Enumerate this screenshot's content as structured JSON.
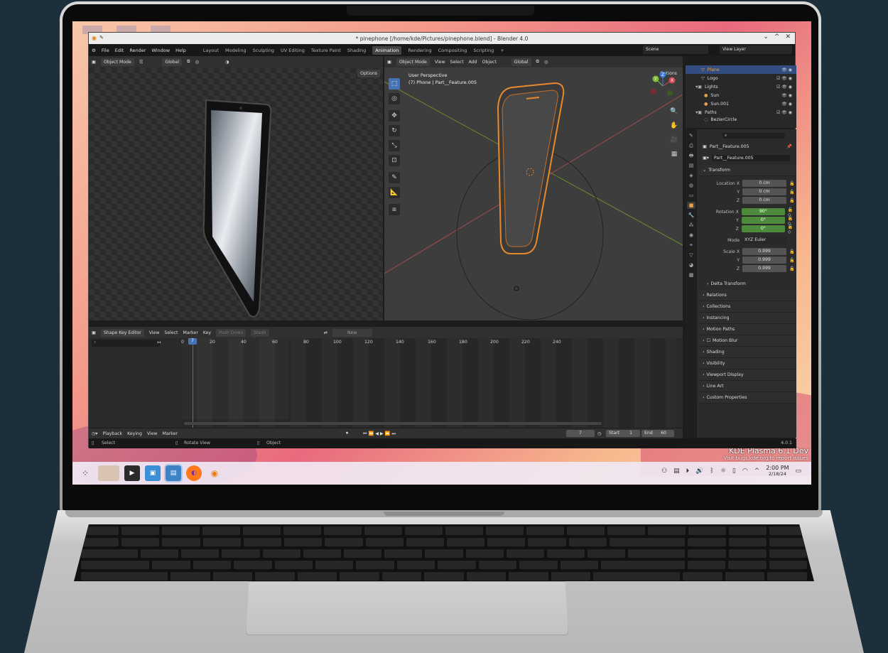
{
  "window": {
    "title": "* pinephone [/home/kde/Pictures/pinephone.blend] - Blender 4.0",
    "buttons": {
      "minimize": "⌄",
      "maximize": "^",
      "close": "✕"
    }
  },
  "menubar": {
    "items": [
      "File",
      "Edit",
      "Render",
      "Window",
      "Help"
    ],
    "workspaces": [
      "Layout",
      "Modeling",
      "Sculpting",
      "UV Editing",
      "Texture Paint",
      "Shading",
      "Animation",
      "Rendering",
      "Compositing",
      "Scripting",
      "+"
    ],
    "active_workspace": "Animation",
    "scene": "Scene",
    "view_layer": "View Layer"
  },
  "left_viewport": {
    "mode": "Object Mode",
    "orientation": "Global",
    "options": "Options"
  },
  "right_viewport": {
    "mode": "Object Mode",
    "menus": [
      "View",
      "Select",
      "Add",
      "Object"
    ],
    "orientation": "Global",
    "options": "Options",
    "overlay_line1": "User Perspective",
    "overlay_line2": "(7) Phone | Part__Feature.005",
    "gizmo_axes": [
      "X",
      "Y",
      "Z"
    ]
  },
  "outliner": {
    "rows": [
      {
        "label": "Plane",
        "selected": true
      },
      {
        "label": "Logo",
        "selected": false
      },
      {
        "label": "Lights",
        "selected": false
      },
      {
        "label": "Sun",
        "selected": false
      },
      {
        "label": "Sun.001",
        "selected": false
      },
      {
        "label": "Paths",
        "selected": false
      },
      {
        "label": "BezierCircle",
        "selected": false
      }
    ]
  },
  "properties": {
    "object_name": "Part__Feature.005",
    "data_name": "Part__Feature.005",
    "transform_title": "Transform",
    "location_label": "Location X",
    "location": [
      "0 cm",
      "0 cm",
      "0 cm"
    ],
    "rotation_label": "Rotation X",
    "rotation": [
      "90°",
      "0°",
      "0°"
    ],
    "mode_label": "Mode",
    "mode_value": "XYZ Euler",
    "scale_label": "Scale X",
    "scale": [
      "0.999",
      "0.999",
      "0.999"
    ],
    "axis_y": "Y",
    "axis_z": "Z",
    "delta_transform": "Delta Transform",
    "sections": [
      "Relations",
      "Collections",
      "Instancing",
      "Motion Paths",
      "Motion Blur",
      "Shading",
      "Visibility",
      "Viewport Display",
      "Line Art",
      "Custom Properties"
    ]
  },
  "shape_key_editor": {
    "editor": "Shape Key Editor",
    "menus": [
      "View",
      "Select",
      "Marker",
      "Key"
    ],
    "push_down": "Push Down",
    "stash": "Stash",
    "new": "New",
    "frame_ticks": [
      "0",
      "20",
      "40",
      "60",
      "80",
      "100",
      "120",
      "140",
      "160",
      "180",
      "200",
      "220",
      "240"
    ],
    "current_frame": "7"
  },
  "timeline_footer": {
    "menus": [
      "Playback",
      "Keying",
      "View",
      "Marker"
    ],
    "current_frame": "7",
    "start_label": "Start",
    "start": "1",
    "end_label": "End",
    "end": "60"
  },
  "statusbar": {
    "select": "Select",
    "rotate": "Rotate View",
    "object": "Object",
    "version": "4.0.1"
  },
  "desktop": {
    "plasma_title": "KDE Plasma 6.1 Dev",
    "plasma_sub": "Visit bugs.kde.org to report issues"
  },
  "taskbar": {
    "time": "2:00 PM",
    "date": "2/18/24"
  },
  "colors": {
    "accent": "#4772b3",
    "selection_orange": "#e8a14a",
    "rotation_green": "#4e8a3d"
  }
}
